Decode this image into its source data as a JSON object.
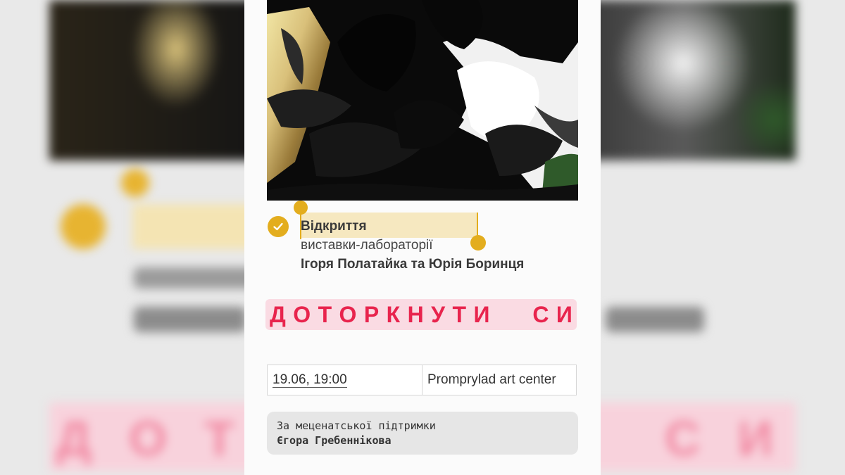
{
  "event": {
    "title_line1": "Відкриття",
    "title_line2": "виставки-лабораторії",
    "title_line3": "Ігоря Полатайка та Юрія Боринця",
    "headline_letters": [
      "Д",
      "О",
      "Т",
      "О",
      "Р",
      "К",
      "Н",
      "У",
      "Т",
      "И",
      "",
      "С",
      "И"
    ],
    "datetime": "19.06, 19:00",
    "venue": "Promprylad art center",
    "sponsor_line1": "За меценатської підтримки",
    "sponsor_line2": "Єгора Гребеннікова"
  },
  "icons": {
    "selection": "checkmark-circle-icon"
  },
  "colors": {
    "accent_yellow": "#e3ad1e",
    "highlight_yellow": "#f6e8c0",
    "headline_red": "#e8244d",
    "headline_bg": "#fadbe3",
    "sponsor_bg": "#e6e6e6"
  }
}
